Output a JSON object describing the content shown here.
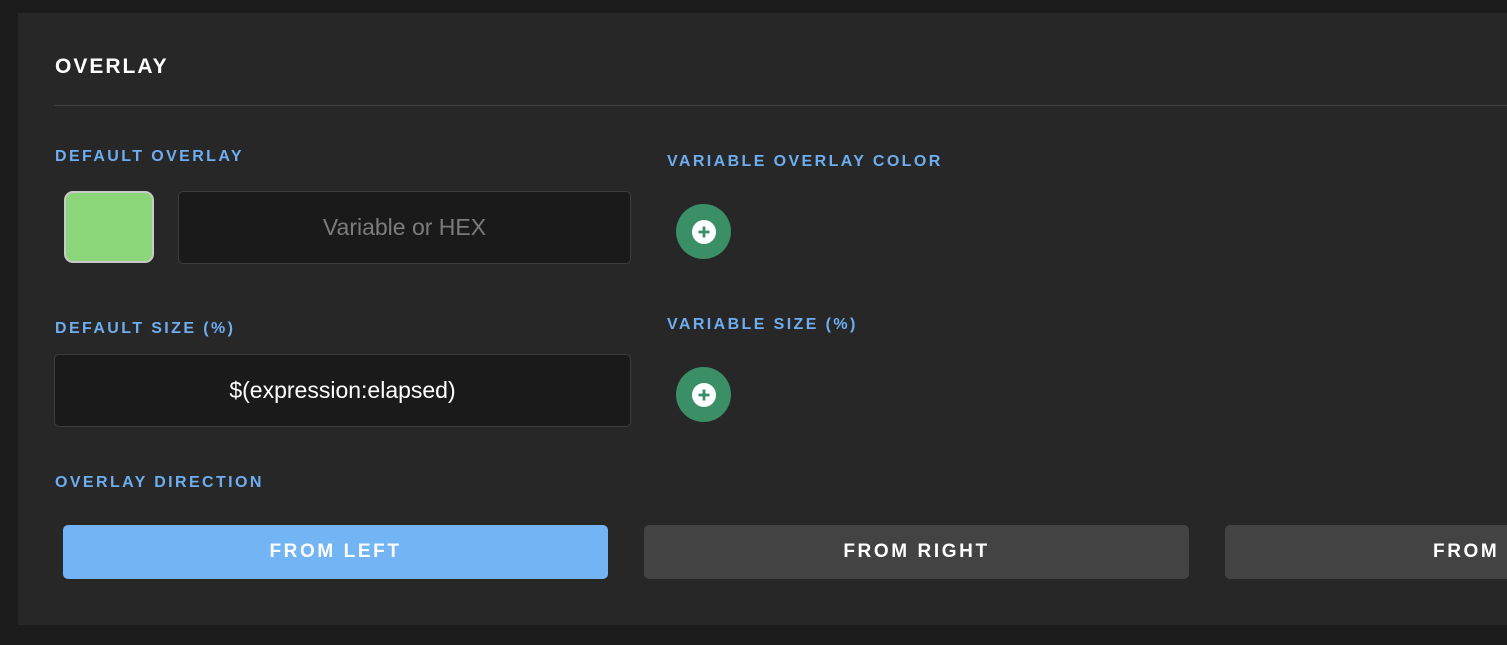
{
  "section": {
    "title": "OVERLAY"
  },
  "default_overlay": {
    "label": "DEFAULT OVERLAY",
    "swatch_color": "#8cd67a",
    "value": "",
    "placeholder": "Variable or HEX"
  },
  "variable_overlay_color": {
    "label": "VARIABLE OVERLAY COLOR",
    "add_icon": "plus-icon"
  },
  "default_size": {
    "label": "DEFAULT SIZE (%)",
    "value": "$(expression:elapsed)"
  },
  "variable_size": {
    "label": "VARIABLE SIZE (%)",
    "add_icon": "plus-icon"
  },
  "overlay_direction": {
    "label": "OVERLAY DIRECTION",
    "selected": "FROM LEFT",
    "options": [
      {
        "label": "FROM LEFT"
      },
      {
        "label": "FROM RIGHT"
      },
      {
        "label": "FROM"
      }
    ]
  },
  "colors": {
    "accent": "#72b4f4",
    "label": "#6eaef0",
    "add_button": "#3b8f66",
    "panel": "#272727"
  }
}
